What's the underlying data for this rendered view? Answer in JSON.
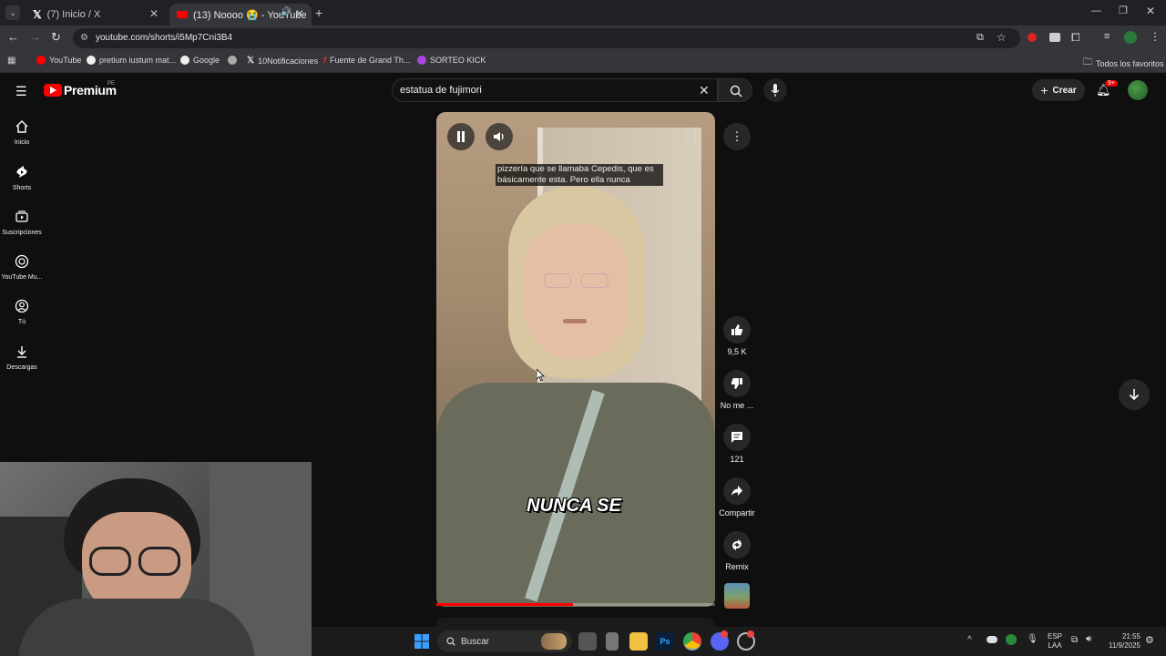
{
  "browser": {
    "tabs": [
      {
        "label": "(7) Inicio / X"
      },
      {
        "label": "(13) Noooo 😭 - YouTube"
      }
    ],
    "url": "youtube.com/shorts/i5Mp7Cni3B4",
    "bookmarks": [
      "YouTube",
      "pretium iustum mat...",
      "Google",
      "10Notificaciones",
      "Fuente de Grand Th...",
      "SORTEO KICK"
    ],
    "all_bookmarks": "Todos los favoritos"
  },
  "youtube": {
    "logo": "Premium",
    "region": "PE",
    "search_value": "estatua de fujimori",
    "create_label": "Crear",
    "notif_badge": "9+",
    "sidebar": [
      {
        "label": "Inicio"
      },
      {
        "label": "Shorts"
      },
      {
        "label": "Suscripciones"
      },
      {
        "label": "YouTube Mu..."
      },
      {
        "label": "Tú"
      },
      {
        "label": "Descargas"
      }
    ],
    "video": {
      "caption": "pizzería que se llamaba Cepedis, que es básicamente esta. Pero ella nunca",
      "subtitle": "NUNCA SE",
      "progress": 0.49
    },
    "actions": {
      "like_count": "9,5 K",
      "dislike_label": "No me ...",
      "comment_count": "121",
      "share_label": "Compartir",
      "remix_label": "Remix"
    }
  },
  "taskbar": {
    "search_label": "Buscar",
    "lang": "ESP",
    "lang2": "LAA",
    "time": "21:55",
    "date": "11/9/2025"
  },
  "colors": {
    "accent": "#ff0000",
    "bg": "#0f0f0f"
  }
}
